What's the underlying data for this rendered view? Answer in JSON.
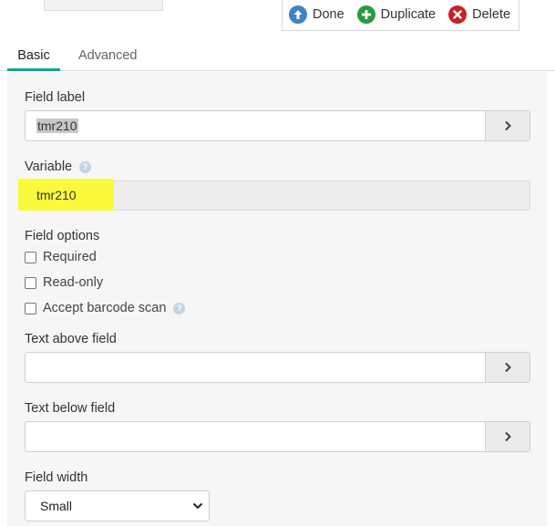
{
  "toolbar": {
    "done_label": "Done",
    "duplicate_label": "Duplicate",
    "delete_label": "Delete",
    "done_color": "#3b84c8",
    "duplicate_color": "#2b9a3e",
    "delete_color": "#c8202a"
  },
  "tabs": [
    {
      "label": "Basic",
      "active": true
    },
    {
      "label": "Advanced",
      "active": false
    }
  ],
  "field_label": {
    "label": "Field label",
    "value": "tmr210",
    "button_icon": "chevron-right-icon"
  },
  "variable": {
    "label": "Variable",
    "value": "tmr210",
    "help_icon": "help-circle-icon",
    "highlight_color": "#fafa3c"
  },
  "field_options": {
    "label": "Field options",
    "options": [
      {
        "label": "Required",
        "checked": false
      },
      {
        "label": "Read-only",
        "checked": false
      },
      {
        "label": "Accept barcode scan",
        "checked": false,
        "help_icon": "help-circle-icon"
      }
    ]
  },
  "text_above": {
    "label": "Text above field",
    "value": ""
  },
  "text_below": {
    "label": "Text below field",
    "value": ""
  },
  "field_width": {
    "label": "Field width",
    "selected": "Small"
  },
  "colors": {
    "tab_accent": "#17a58a",
    "panel_bg": "#f6f6f6"
  }
}
